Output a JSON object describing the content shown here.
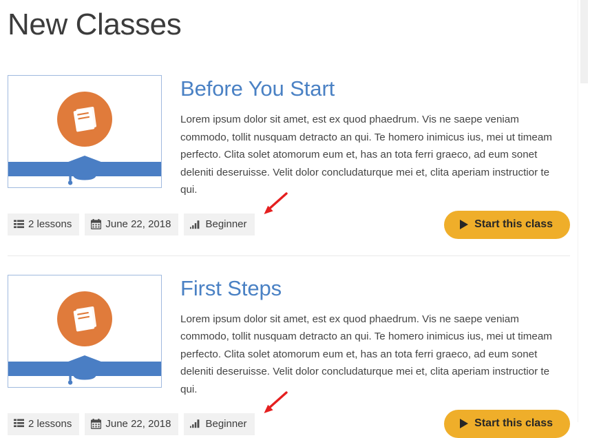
{
  "page": {
    "title": "New Classes",
    "background_color": "#ffffff",
    "title_color": "#3c3c3c"
  },
  "theme": {
    "accent_blue": "#4a81c4",
    "accent_orange": "#e07b3b",
    "button_amber": "#efae2a",
    "badge_gray": "#f1f1f1",
    "divider_gray": "#e8e8e8",
    "annotation_red": "#e51f1f"
  },
  "scrollbar": {
    "name": "vertical-scrollbar",
    "thumb_top": 0,
    "thumb_height": 121
  },
  "classes": [
    {
      "title": "Before You Start",
      "description": "Lorem ipsum dolor sit amet, est ex quod phaedrum. Vis ne saepe veniam commodo, tollit nusquam detracto an qui. Te homero inimicus ius, mei ut timeam perfecto. Clita solet atomorum eum et, has an tota ferri graeco, ad eum sonet deleniti deseruisse. Velit dolor concludaturque mei et, clita aperiam instructior te qui.",
      "thumbnail": {
        "icon": "book-icon",
        "badge_icon": "graduation-cap-icon"
      },
      "badges": [
        {
          "icon": "list-icon",
          "label": "2 lessons"
        },
        {
          "icon": "calendar-icon",
          "label": "June 22, 2018"
        },
        {
          "icon": "signal-bars-icon",
          "label": "Beginner"
        }
      ],
      "cta": {
        "icon": "play-icon",
        "label": "Start this class"
      },
      "annotation": {
        "icon": "red-arrow-icon",
        "points_at": "Beginner"
      }
    },
    {
      "title": "First Steps",
      "description": "Lorem ipsum dolor sit amet, est ex quod phaedrum. Vis ne saepe veniam commodo, tollit nusquam detracto an qui. Te homero inimicus ius, mei ut timeam perfecto. Clita solet atomorum eum et, has an tota ferri graeco, ad eum sonet deleniti deseruisse. Velit dolor concludaturque mei et, clita aperiam instructior te qui.",
      "thumbnail": {
        "icon": "book-icon",
        "badge_icon": "graduation-cap-icon"
      },
      "badges": [
        {
          "icon": "list-icon",
          "label": "2 lessons"
        },
        {
          "icon": "calendar-icon",
          "label": "June 22, 2018"
        },
        {
          "icon": "signal-bars-icon",
          "label": "Beginner"
        }
      ],
      "cta": {
        "icon": "play-icon",
        "label": "Start this class"
      },
      "annotation": {
        "icon": "red-arrow-icon",
        "points_at": "Beginner"
      }
    }
  ]
}
